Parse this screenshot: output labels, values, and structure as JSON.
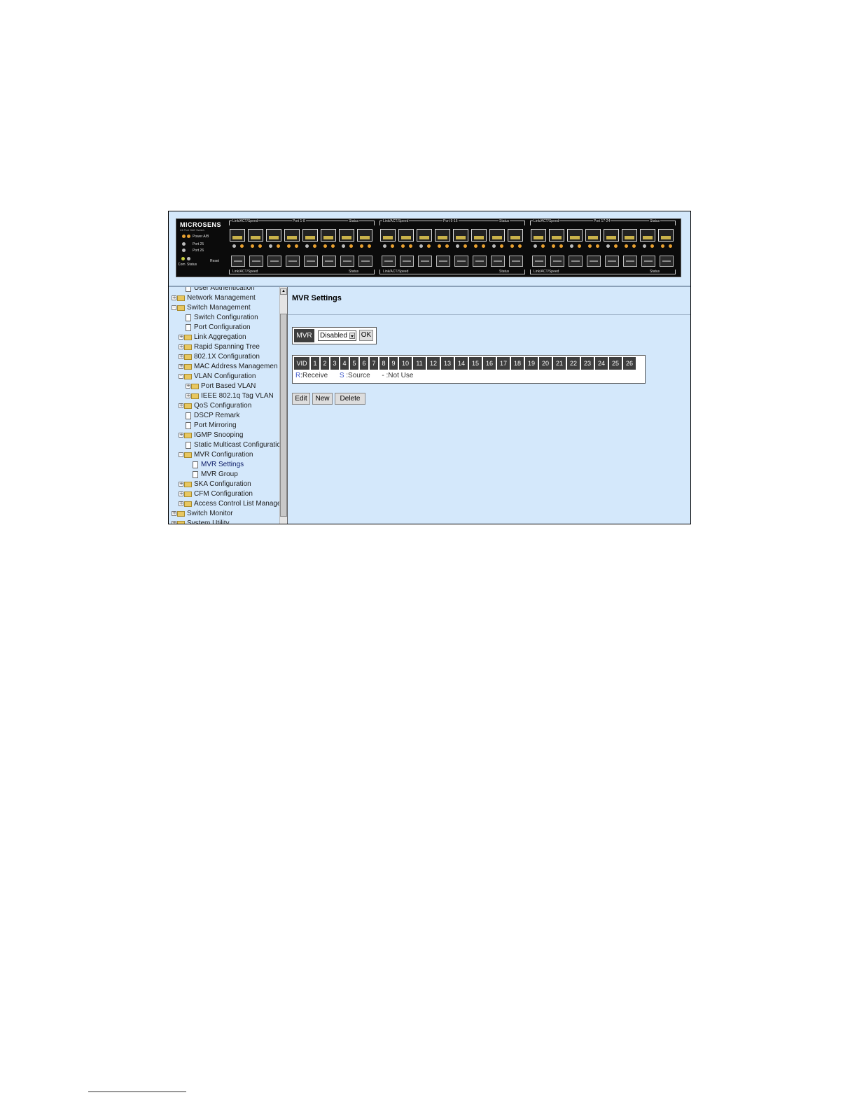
{
  "device": {
    "brand": "MICROSENS",
    "model": "24 Port GbE Switch",
    "power_label": "Power A/B",
    "port25_label": "Port 25",
    "port26_label": "Port 26",
    "com_label": "Com",
    "status_label": "Status",
    "reset_label": "Reset",
    "groups": [
      {
        "top_left": "Link/ACT/Speed",
        "title": "Port 1-8",
        "top_right": "Status",
        "bottom_left": "Link/ACT/Speed",
        "bottom_right": "Status"
      },
      {
        "top_left": "Link/ACT/Speed",
        "title": "Port 9-16",
        "top_right": "Status",
        "bottom_left": "Link/ACT/Speed",
        "bottom_right": "Status"
      },
      {
        "top_left": "Link/ACT/Speed",
        "title": "Port 17-24",
        "top_right": "Status",
        "bottom_left": "Link/ACT/Speed",
        "bottom_right": "Status"
      }
    ]
  },
  "nav": {
    "items": [
      {
        "label": "User Authentication",
        "type": "doc",
        "level": 1
      },
      {
        "label": "Network Management",
        "type": "folder",
        "level": 0,
        "expander": "+"
      },
      {
        "label": "Switch Management",
        "type": "folder-open",
        "level": 0,
        "expander": "-"
      },
      {
        "label": "Switch Configuration",
        "type": "doc",
        "level": 1
      },
      {
        "label": "Port Configuration",
        "type": "doc",
        "level": 1
      },
      {
        "label": "Link Aggregation",
        "type": "folder",
        "level": 1,
        "expander": "+"
      },
      {
        "label": "Rapid Spanning Tree",
        "type": "folder",
        "level": 1,
        "expander": "+"
      },
      {
        "label": "802.1X Configuration",
        "type": "folder",
        "level": 1,
        "expander": "+"
      },
      {
        "label": "MAC Address Managemen",
        "type": "folder",
        "level": 1,
        "expander": "+"
      },
      {
        "label": "VLAN Configuration",
        "type": "folder-open",
        "level": 1,
        "expander": "-"
      },
      {
        "label": "Port Based VLAN",
        "type": "folder",
        "level": 2,
        "expander": "+"
      },
      {
        "label": "IEEE 802.1q Tag VLAN",
        "type": "folder",
        "level": 2,
        "expander": "+"
      },
      {
        "label": "QoS Configuration",
        "type": "folder",
        "level": 1,
        "expander": "+"
      },
      {
        "label": "DSCP Remark",
        "type": "doc",
        "level": 1
      },
      {
        "label": "Port Mirroring",
        "type": "doc",
        "level": 1
      },
      {
        "label": "IGMP Snooping",
        "type": "folder",
        "level": 1,
        "expander": "+"
      },
      {
        "label": "Static Multicast Configuratic",
        "type": "doc",
        "level": 1
      },
      {
        "label": "MVR Configuration",
        "type": "folder-open",
        "level": 1,
        "expander": "-"
      },
      {
        "label": "MVR Settings",
        "type": "doc",
        "level": 2
      },
      {
        "label": "MVR Group",
        "type": "doc",
        "level": 2
      },
      {
        "label": "SKA Configuration",
        "type": "folder",
        "level": 1,
        "expander": "+"
      },
      {
        "label": "CFM Configuration",
        "type": "folder",
        "level": 1,
        "expander": "+"
      },
      {
        "label": "Access Control List Manage",
        "type": "folder",
        "level": 1,
        "expander": "+"
      },
      {
        "label": "Switch Monitor",
        "type": "folder",
        "level": 0,
        "expander": "+"
      },
      {
        "label": "System Utility",
        "type": "folder",
        "level": 0,
        "expander": "+"
      }
    ]
  },
  "main": {
    "title": "MVR Settings",
    "mvr_label": "MVR",
    "mvr_select_value": "Disabled",
    "ok_label": "OK",
    "table_header": [
      "VID",
      "1",
      "2",
      "3",
      "4",
      "5",
      "6",
      "7",
      "8",
      "9",
      "10",
      "11",
      "12",
      "13",
      "14",
      "15",
      "16",
      "17",
      "18",
      "19",
      "20",
      "21",
      "22",
      "23",
      "24",
      "25",
      "26"
    ],
    "legend": {
      "r_key": "R",
      "r_text": ":Receive",
      "s_key": "S",
      "s_text": ":Source",
      "n_key": "-",
      "n_text": ":Not Use"
    },
    "buttons": {
      "edit": "Edit",
      "new": "New",
      "delete": "Delete"
    }
  }
}
